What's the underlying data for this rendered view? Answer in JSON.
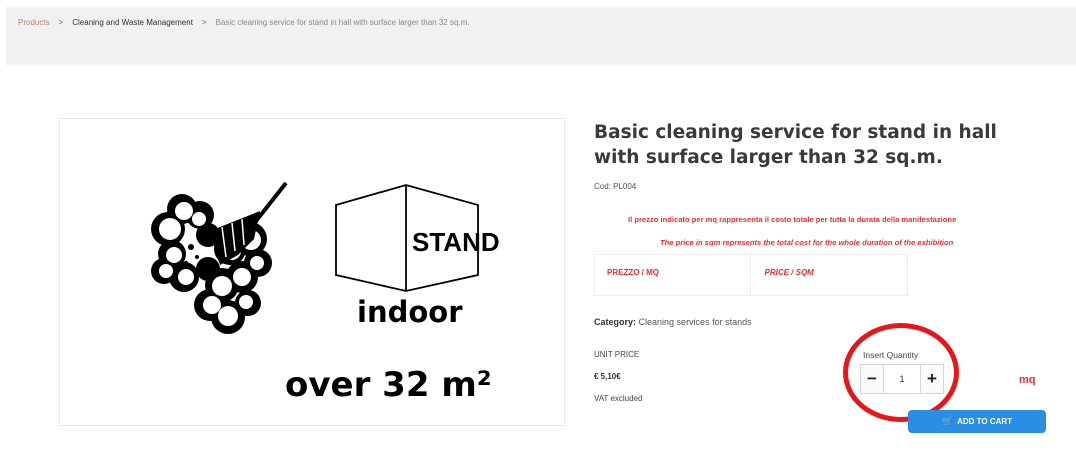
{
  "breadcrumb": {
    "items": [
      "Products",
      "Cleaning and Waste Management",
      "Basic cleaning service for stand in hall with surface larger than 32 sq.m."
    ],
    "separator": ">"
  },
  "image": {
    "stand_label": "STAND",
    "indoor_label": "indoor",
    "size_label": "over 32 m²",
    "icons": [
      "broom-cleaning-icon",
      "stand-box-icon"
    ]
  },
  "product": {
    "title": "Basic cleaning service for stand in hall with surface larger than 32 sq.m.",
    "code": "Cod: PL004",
    "notice_it": "Il prezzo indicato per mq rappresenta il costo totale per tutta la durata della manifestazione",
    "notice_en": "The price in sqm represents the total cost for the whole duration of the exhibition",
    "price_table": [
      "PREZZO / MQ",
      "PRICE / SQM"
    ],
    "category_key": "Category:",
    "category_value": "Cleaning services for stands",
    "unit_price_label": "UNIT PRICE",
    "unit_price_value": "€ 5,10€",
    "vat_note": "VAT excluded"
  },
  "quantity": {
    "label": "Insert Quantity",
    "value": "1",
    "minus": "−",
    "plus": "+",
    "unit": "mq"
  },
  "cart": {
    "label": "ADD TO CART",
    "icon": "cart-icon"
  },
  "colors": {
    "accent_red": "#e83030",
    "annotation_red": "#e8151b",
    "button_blue": "#2a8ee4",
    "breadcrumb_bg": "#f1f1f3"
  }
}
